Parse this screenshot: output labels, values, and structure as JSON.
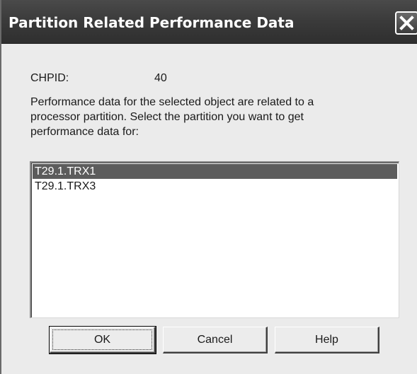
{
  "window": {
    "title": "Partition Related Performance Data",
    "close_icon": "close-icon"
  },
  "chpid": {
    "label": "CHPID:",
    "value": "40"
  },
  "description": {
    "line1": "Performance data for the selected object are related to a",
    "line2": "processor partition. Select the partition you want to get",
    "line3": "performance data for:"
  },
  "partitions": {
    "items": [
      {
        "label": "T29.1.TRX1",
        "selected": true
      },
      {
        "label": "T29.1.TRX3",
        "selected": false
      }
    ]
  },
  "buttons": {
    "ok_label": "OK",
    "cancel_label": "Cancel",
    "help_label": "Help"
  },
  "colors": {
    "title_bar": "#3a3a3a",
    "selection": "#5c5c5c",
    "dialog_bg": "#ebebeb"
  }
}
